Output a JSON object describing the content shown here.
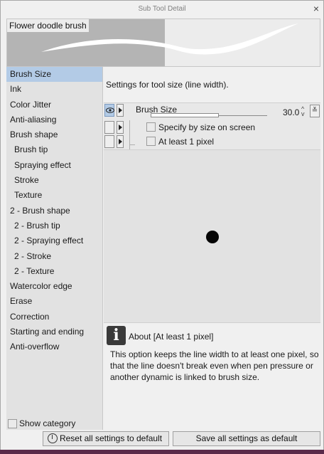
{
  "window": {
    "title": "Sub Tool Detail",
    "close_glyph": "×"
  },
  "preview": {
    "brush_name": "Flower doodle brush"
  },
  "sidebar": {
    "items": [
      {
        "label": "Brush Size",
        "selected": true,
        "sub": false
      },
      {
        "label": "Ink",
        "sub": false
      },
      {
        "label": "Color Jitter",
        "sub": false
      },
      {
        "label": "Anti-aliasing",
        "sub": false
      },
      {
        "label": "Brush shape",
        "sub": false
      },
      {
        "label": "Brush tip",
        "sub": true
      },
      {
        "label": "Spraying effect",
        "sub": true
      },
      {
        "label": "Stroke",
        "sub": true
      },
      {
        "label": "Texture",
        "sub": true
      },
      {
        "label": "2 - Brush shape",
        "sub": false
      },
      {
        "label": "2 - Brush tip",
        "sub": true
      },
      {
        "label": "2 - Spraying effect",
        "sub": true
      },
      {
        "label": "2 - Stroke",
        "sub": true
      },
      {
        "label": "2 - Texture",
        "sub": true
      },
      {
        "label": "Watercolor edge",
        "sub": false
      },
      {
        "label": "Erase",
        "sub": false
      },
      {
        "label": "Correction",
        "sub": false
      },
      {
        "label": "Starting and ending",
        "sub": false
      },
      {
        "label": "Anti-overflow",
        "sub": false
      }
    ],
    "show_category_label": "Show category"
  },
  "main": {
    "description": "Settings for tool size (line width).",
    "brush_size": {
      "label": "Brush Size",
      "value": "30.0",
      "spin_up": "^",
      "spin_down": "v",
      "dropdown_glyph": "≚"
    },
    "specify_by_size_label": "Specify by size on screen",
    "at_least_one_label": "At least 1 pixel"
  },
  "about": {
    "icon_glyph": "i",
    "title": "About [At least 1 pixel]",
    "text": "This option keeps the line width to at least one pixel, so that the line doesn't break even when pen pressure or another dynamic is linked to brush size."
  },
  "footer": {
    "reset_label": "Reset all settings to default",
    "save_label": "Save all settings as default"
  }
}
